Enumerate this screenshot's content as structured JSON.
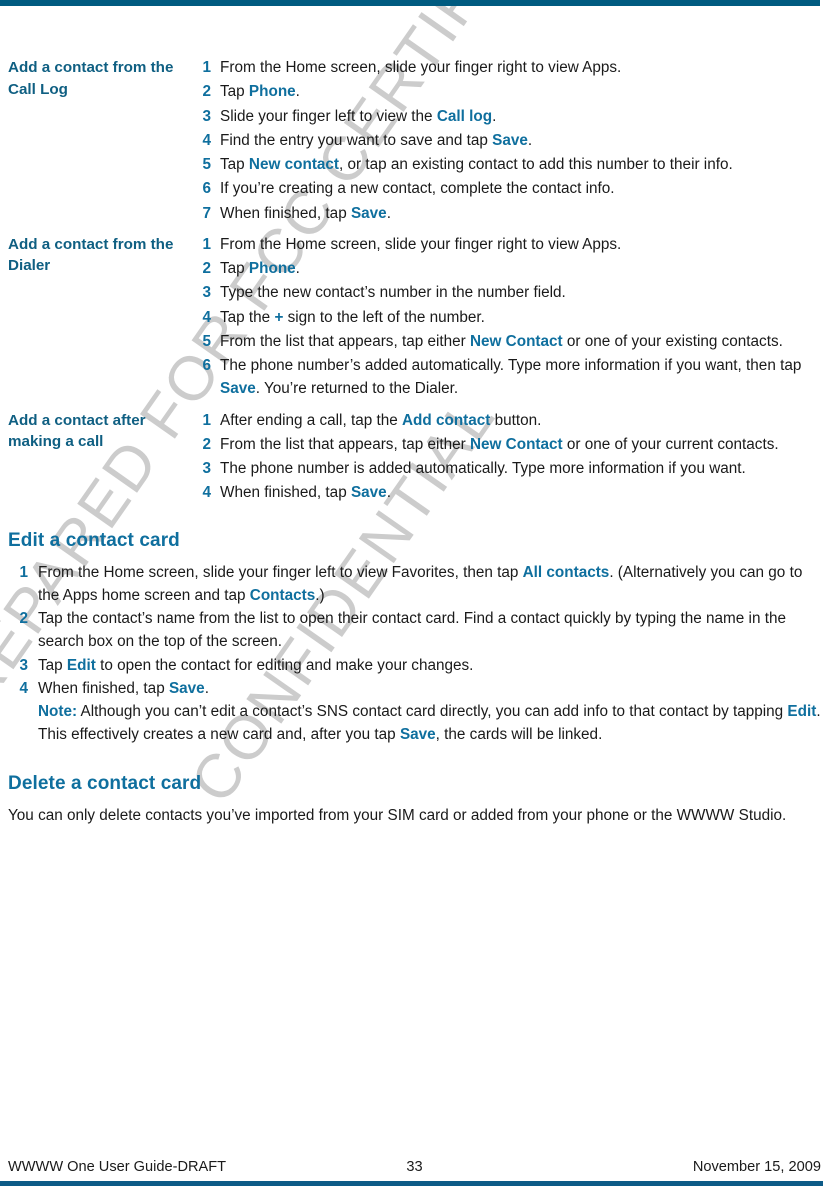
{
  "document": {
    "title": "WWWW One User Guide-DRAFT",
    "accent_dark": "#005b80",
    "accent_heading": "#0f6f9e",
    "accent_label": "#0f5f82",
    "body_color": "#1a1a1a"
  },
  "watermark": {
    "line1": "PREPARED FOR FCC CERTIFICATION",
    "line2": "CONFIDENTIAL",
    "color": "#b9b9b9"
  },
  "blocks": [
    {
      "label": "Add a contact from the Call Log",
      "steps": [
        {
          "n": "1",
          "html": "From the Home screen, slide your finger right to view Apps."
        },
        {
          "n": "2",
          "html": "Tap <b class=\"term\">Phone</b>."
        },
        {
          "n": "3",
          "html": "Slide your finger left to view the <b class=\"term\">Call log</b>."
        },
        {
          "n": "4",
          "html": "Find the entry you want to save and tap <b class=\"term\">Save</b>."
        },
        {
          "n": "5",
          "html": "Tap <b class=\"term\">New contact</b>, or tap an existing contact to add this number to their info."
        },
        {
          "n": "6",
          "html": "If you’re creating a new contact, complete the contact info."
        },
        {
          "n": "7",
          "html": "When finished, tap <b class=\"term\">Save</b>."
        }
      ]
    },
    {
      "label": "Add a contact from the Dialer",
      "steps": [
        {
          "n": "1",
          "html": "From the Home screen, slide your finger right to view Apps."
        },
        {
          "n": "2",
          "html": "Tap <b class=\"term\">Phone</b>."
        },
        {
          "n": "3",
          "html": "Type the new contact’s number in the number field."
        },
        {
          "n": "4",
          "html": "Tap the <b class=\"term\">+</b> sign to the left of the number."
        },
        {
          "n": "5",
          "html": "From the list that appears, tap either <b class=\"term\">New Contact</b> or one of your existing contacts."
        },
        {
          "n": "6",
          "html": "The phone number’s added automatically. Type more information if you want, then tap <b class=\"term\">Save</b>. You’re returned to the Dialer."
        }
      ]
    },
    {
      "label": "Add a contact after making a call",
      "steps": [
        {
          "n": "1",
          "html": "After ending a call, tap the <b class=\"term\">Add contact</b> button."
        },
        {
          "n": "2",
          "html": "From the list that appears, tap either <b class=\"term\">New Contact</b> or one of your current contacts."
        },
        {
          "n": "3",
          "html": "The phone number is added automatically. Type more information if you want."
        },
        {
          "n": "4",
          "html": "When finished, tap <b class=\"term\">Save</b>."
        }
      ]
    }
  ],
  "sections": [
    {
      "heading": "Edit a contact card",
      "steps": [
        {
          "n": "1",
          "html": "From the Home screen, slide your finger left to view Favorites, then tap <b class=\"term\">All contacts</b>. (Alternatively you can go to the Apps home screen and tap <b class=\"term\">Contacts</b>.)"
        },
        {
          "n": "2",
          "html": "Tap the contact’s name from the list to open their contact card. Find a contact quickly by typing the name in the search box on the top of the screen."
        },
        {
          "n": "3",
          "html": "Tap <b class=\"term\">Edit</b> to open the contact for editing and make your changes."
        },
        {
          "n": "4",
          "html": "When finished, tap <b class=\"term\">Save</b>.<br><b class=\"note-lbl\">Note:</b> Although you can’t edit a contact’s SNS contact card directly, you can add info to that contact by tapping <b class=\"term\">Edit</b>. This effectively creates a new card and, after you tap <b class=\"term\">Save</b>, the cards will be linked."
        }
      ]
    },
    {
      "heading": "Delete a contact card",
      "paragraph": "You can only delete contacts you’ve imported from your SIM card or added from your phone or the WWWW Studio."
    }
  ],
  "footer": {
    "left": "WWWW One User Guide-DRAFT",
    "page_number": "33",
    "right": "November 15, 2009"
  }
}
